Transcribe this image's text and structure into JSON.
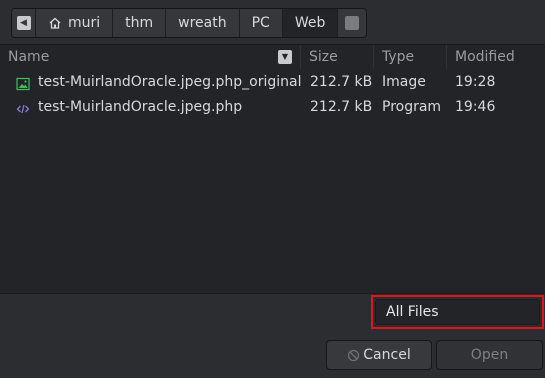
{
  "pathbar": {
    "back_icon": "left-arrow-icon",
    "forward_icon": "right-arrow-icon",
    "crumbs": [
      {
        "label": "muri",
        "icon": "home-icon"
      },
      {
        "label": "thm"
      },
      {
        "label": "wreath"
      },
      {
        "label": "PC"
      },
      {
        "label": "Web",
        "active": true
      }
    ]
  },
  "columns": {
    "name": "Name",
    "size": "Size",
    "type": "Type",
    "modified": "Modified"
  },
  "files": [
    {
      "name": "test-MuirlandOracle.jpeg.php_original",
      "size": "212.7 kB",
      "type": "Image",
      "modified": "19:28",
      "icon": "image-file-icon"
    },
    {
      "name": "test-MuirlandOracle.jpeg.php",
      "size": "212.7 kB",
      "type": "Program",
      "modified": "19:46",
      "icon": "code-file-icon"
    }
  ],
  "filter": {
    "value": "All Files",
    "highlight_color": "#e0141b"
  },
  "buttons": {
    "cancel": "Cancel",
    "open": "Open"
  }
}
